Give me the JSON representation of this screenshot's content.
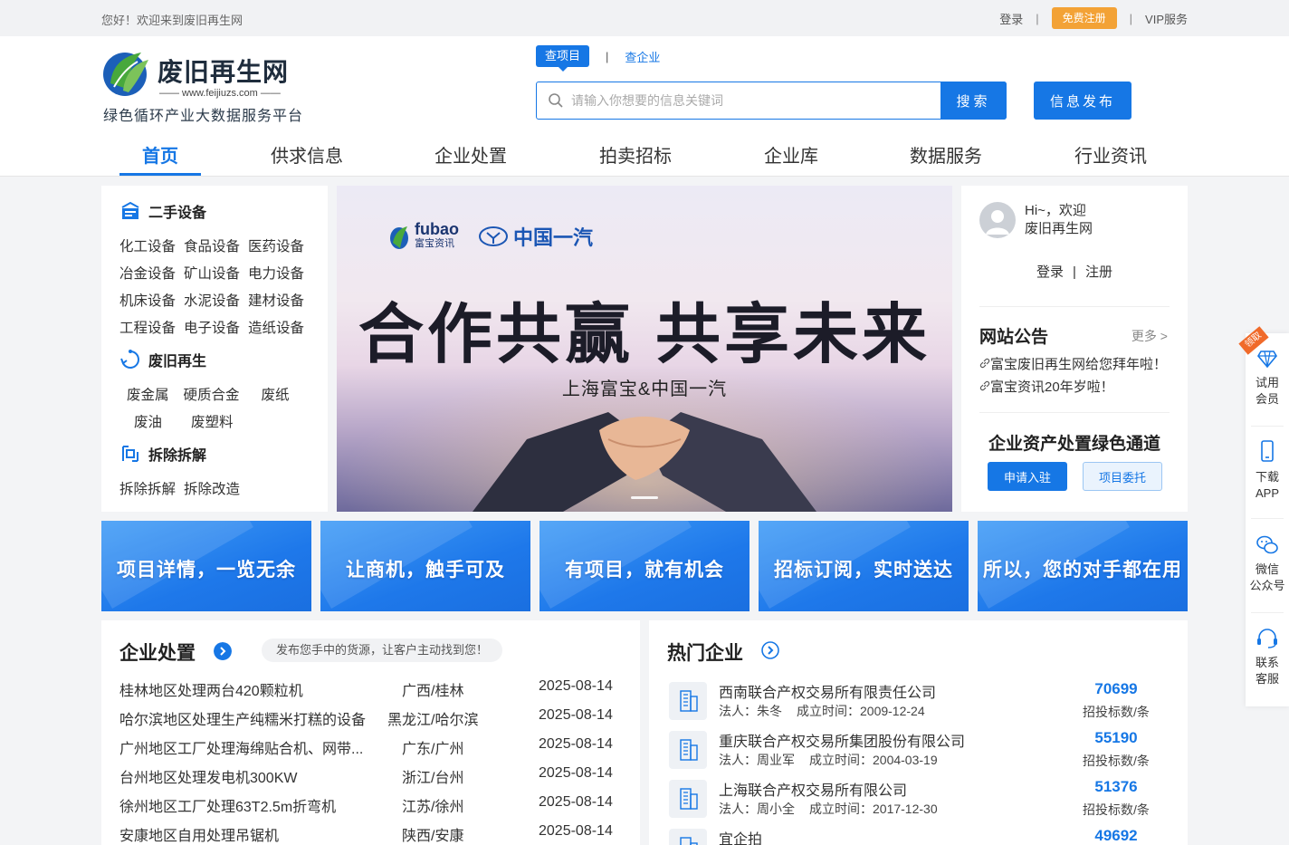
{
  "topbar": {
    "greeting": "您好！欢迎来到废旧再生网",
    "login": "登录",
    "sep": "|",
    "register": "免费注册",
    "vip": "VIP服务"
  },
  "logo": {
    "name": "废旧再生网",
    "url": "—— www.feijiuzs.com ——",
    "slogan": "绿色循环产业大数据服务平台"
  },
  "search": {
    "tab_active": "查项目",
    "tab_sep": "|",
    "tab_other": "查企业",
    "placeholder": "请输入你想要的信息关键词",
    "button": "搜索",
    "publish": "信息发布"
  },
  "nav": {
    "items": [
      "首页",
      "供求信息",
      "企业处置",
      "拍卖招标",
      "企业库",
      "数据服务",
      "行业资讯"
    ]
  },
  "categories": {
    "used_equipment": {
      "title": "二手设备",
      "rows": [
        [
          "化工设备",
          "食品设备",
          "医药设备"
        ],
        [
          "冶金设备",
          "矿山设备",
          "电力设备"
        ],
        [
          "机床设备",
          "水泥设备",
          "建材设备"
        ],
        [
          "工程设备",
          "电子设备",
          "造纸设备"
        ]
      ]
    },
    "recycle": {
      "title": "废旧再生",
      "row1": [
        "废金属",
        "硬质合金",
        "废纸"
      ],
      "row2": [
        "废油",
        "废塑料"
      ]
    },
    "demolition": {
      "title": "拆除拆解",
      "rows": [
        [
          "拆除拆解",
          "拆除改造"
        ]
      ]
    }
  },
  "banner": {
    "fubao_en": "fubao",
    "fubao_cn": "富宝资讯",
    "faw": "中国一汽",
    "headline": "合作共赢  共享未来",
    "sub": "上海富宝&中国一汽"
  },
  "user": {
    "hi_line1": "Hi~，欢迎",
    "hi_line2": "废旧再生网",
    "login": "登录",
    "sep": "|",
    "register": "注册",
    "notice_title": "网站公告",
    "notice_more": "更多 >",
    "notices": [
      "富宝废旧再生网给您拜年啦！",
      "富宝资讯20年岁啦！"
    ],
    "green_title": "企业资产处置绿色通道",
    "apply": "申请入驻",
    "entrust": "项目委托"
  },
  "promos": [
    "项目详情，一览无余",
    "让商机，触手可及",
    "有项目，就有机会",
    "招标订阅，实时送达",
    "所以，您的对手都在用"
  ],
  "disposal": {
    "title": "企业处置",
    "tip": "发布您手中的货源，让客户主动找到您！",
    "rows": [
      {
        "title": "桂林地区处理两台420颗粒机",
        "region": "广西/桂林",
        "date": "2025-08-14"
      },
      {
        "title": "哈尔滨地区处理生产纯糯米打糕的设备",
        "region": "黑龙江/哈尔滨",
        "date": "2025-08-14"
      },
      {
        "title": "广州地区工厂处理海绵贴合机、网带...",
        "region": "广东/广州",
        "date": "2025-08-14"
      },
      {
        "title": "台州地区处理发电机300KW",
        "region": "浙江/台州",
        "date": "2025-08-14"
      },
      {
        "title": "徐州地区工厂处理63T2.5m折弯机",
        "region": "江苏/徐州",
        "date": "2025-08-14"
      },
      {
        "title": "安康地区自用处理吊锯机",
        "region": "陕西/安康",
        "date": "2025-08-14"
      }
    ]
  },
  "hot": {
    "title": "热门企业",
    "items": [
      {
        "name": "西南联合产权交易所有限责任公司",
        "legal": "法人：朱冬",
        "founded": "成立时间：2009-12-24",
        "count": "70699",
        "label": "招投标数/条"
      },
      {
        "name": "重庆联合产权交易所集团股份有限公司",
        "legal": "法人：周业军",
        "founded": "成立时间：2004-03-19",
        "count": "55190",
        "label": "招投标数/条"
      },
      {
        "name": "上海联合产权交易所有限公司",
        "legal": "法人：周小全",
        "founded": "成立时间：2017-12-30",
        "count": "51376",
        "label": "招投标数/条"
      },
      {
        "name": "宜企拍",
        "legal": "",
        "founded": "",
        "count": "49692",
        "label": ""
      }
    ]
  },
  "float": {
    "ribbon": "领取",
    "trial_1": "试用",
    "trial_2": "会员",
    "app_1": "下载",
    "app_2": "APP",
    "wechat_1": "微信",
    "wechat_2": "公众号",
    "service_1": "联系",
    "service_2": "客服"
  },
  "colors": {
    "brand_blue": "#1677e5",
    "register_orange": "#f3a236",
    "page_bg": "#f3f4f6"
  }
}
